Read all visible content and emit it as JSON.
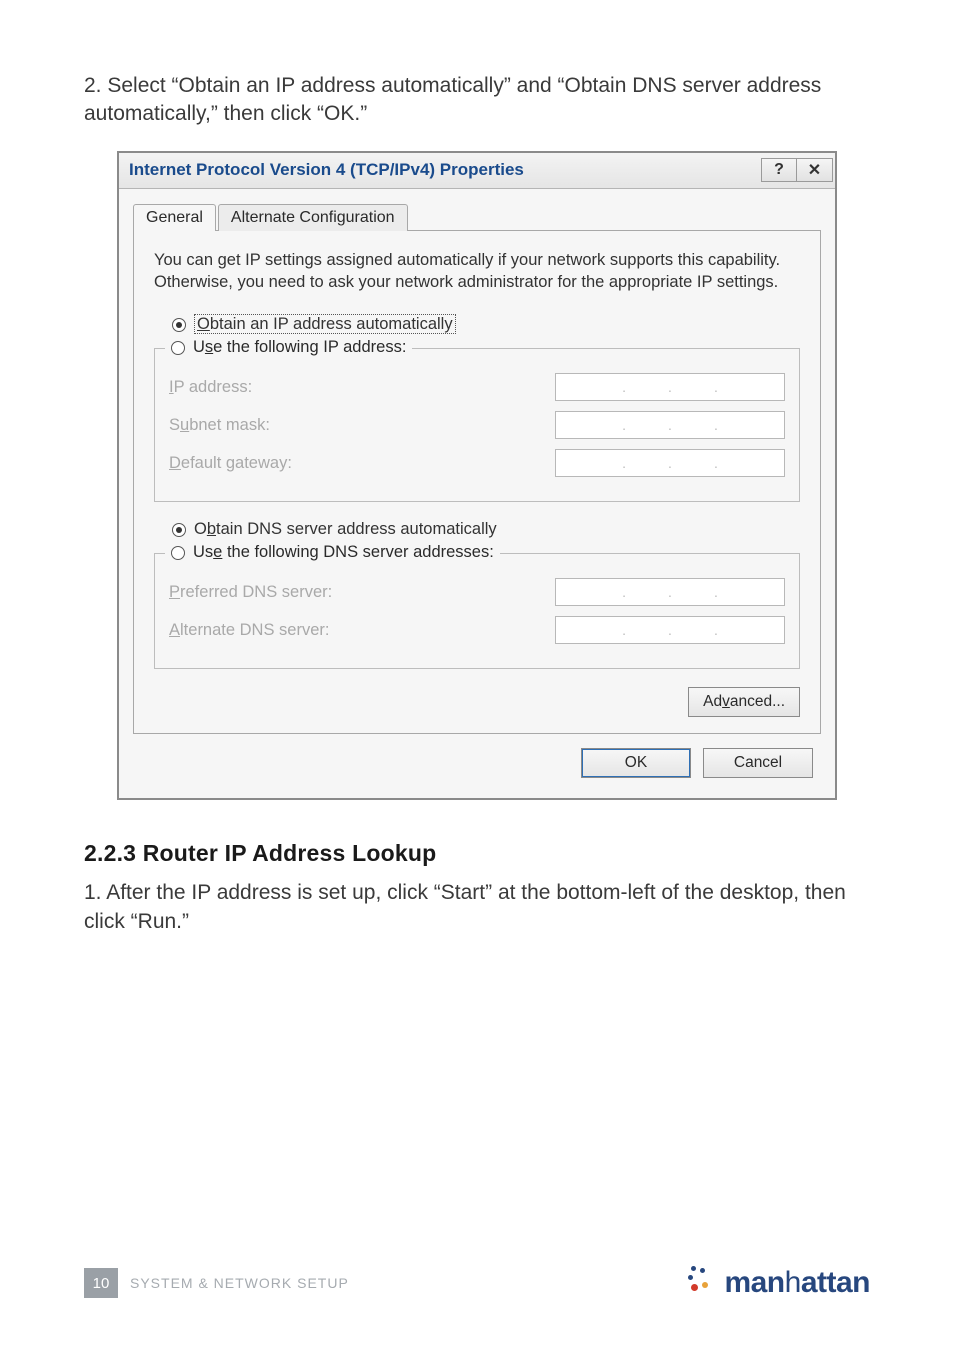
{
  "instruction_top": "2. Select “Obtain an IP address automatically” and “Obtain DNS server address automatically,” then click “OK.”",
  "dialog": {
    "title": "Internet Protocol Version 4 (TCP/IPv4) Properties",
    "help_glyph": "?",
    "close_glyph": "✕",
    "tabs": {
      "general": "General",
      "alt": "Alternate Configuration"
    },
    "info": "You can get IP settings assigned automatically if your network supports this capability. Otherwise, you need to ask your network administrator for the appropriate IP settings.",
    "radios": {
      "obtain_ip": "Obtain an IP address automatically",
      "use_ip": "Use the following IP address:",
      "obtain_dns": "Obtain DNS server address automatically",
      "use_dns": "Use the following DNS server addresses:"
    },
    "labels": {
      "ip": "IP address:",
      "subnet": "Subnet mask:",
      "gateway": "Default gateway:",
      "pref_dns": "Preferred DNS server:",
      "alt_dns": "Alternate DNS server:"
    },
    "advanced": "Advanced...",
    "ok": "OK",
    "cancel": "Cancel"
  },
  "section": {
    "heading": "2.2.3  Router IP Address Lookup",
    "text": "1. After the IP address is set up, click “Start” at the bottom-left of the desktop, then click “Run.”"
  },
  "footer": {
    "page": "10",
    "caption": "SYSTEM & NETWORK SETUP",
    "brand": "manhattan"
  },
  "brand_colors": {
    "blue": "#27477e",
    "red": "#d23a2a",
    "orange": "#e8a23a"
  }
}
